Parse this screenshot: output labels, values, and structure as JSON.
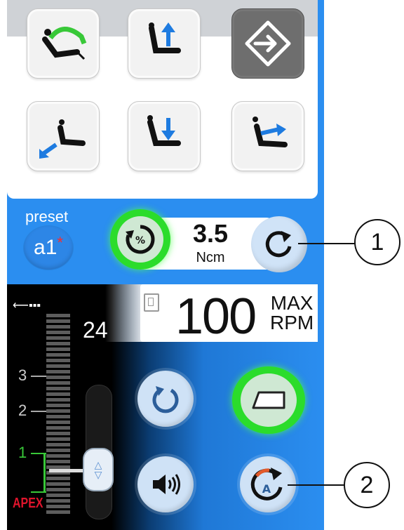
{
  "chair_controls": {
    "buttons": [
      {
        "icon": "chair-recline-green-arc-icon"
      },
      {
        "icon": "chair-up-icon"
      },
      {
        "icon": "exit-icon"
      },
      {
        "icon": "chair-tilt-back-icon"
      },
      {
        "icon": "chair-down-icon"
      },
      {
        "icon": "chair-return-icon"
      }
    ]
  },
  "preset": {
    "label": "preset",
    "value": "a1",
    "modified_mark": "*"
  },
  "torque": {
    "value": "3.5",
    "unit": "Ncm"
  },
  "speed": {
    "value": "100",
    "max_label": "MAX",
    "unit": "RPM"
  },
  "apex": {
    "count": "24",
    "label": "APEX",
    "scale": [
      "3",
      "2",
      "1"
    ]
  },
  "callouts": [
    "1",
    "2"
  ],
  "colors": {
    "panel_blue": "#2b8ef0",
    "active_green": "#2bdc2b",
    "apex_red": "#e0142c",
    "arrow_blue": "#1e7be0"
  }
}
